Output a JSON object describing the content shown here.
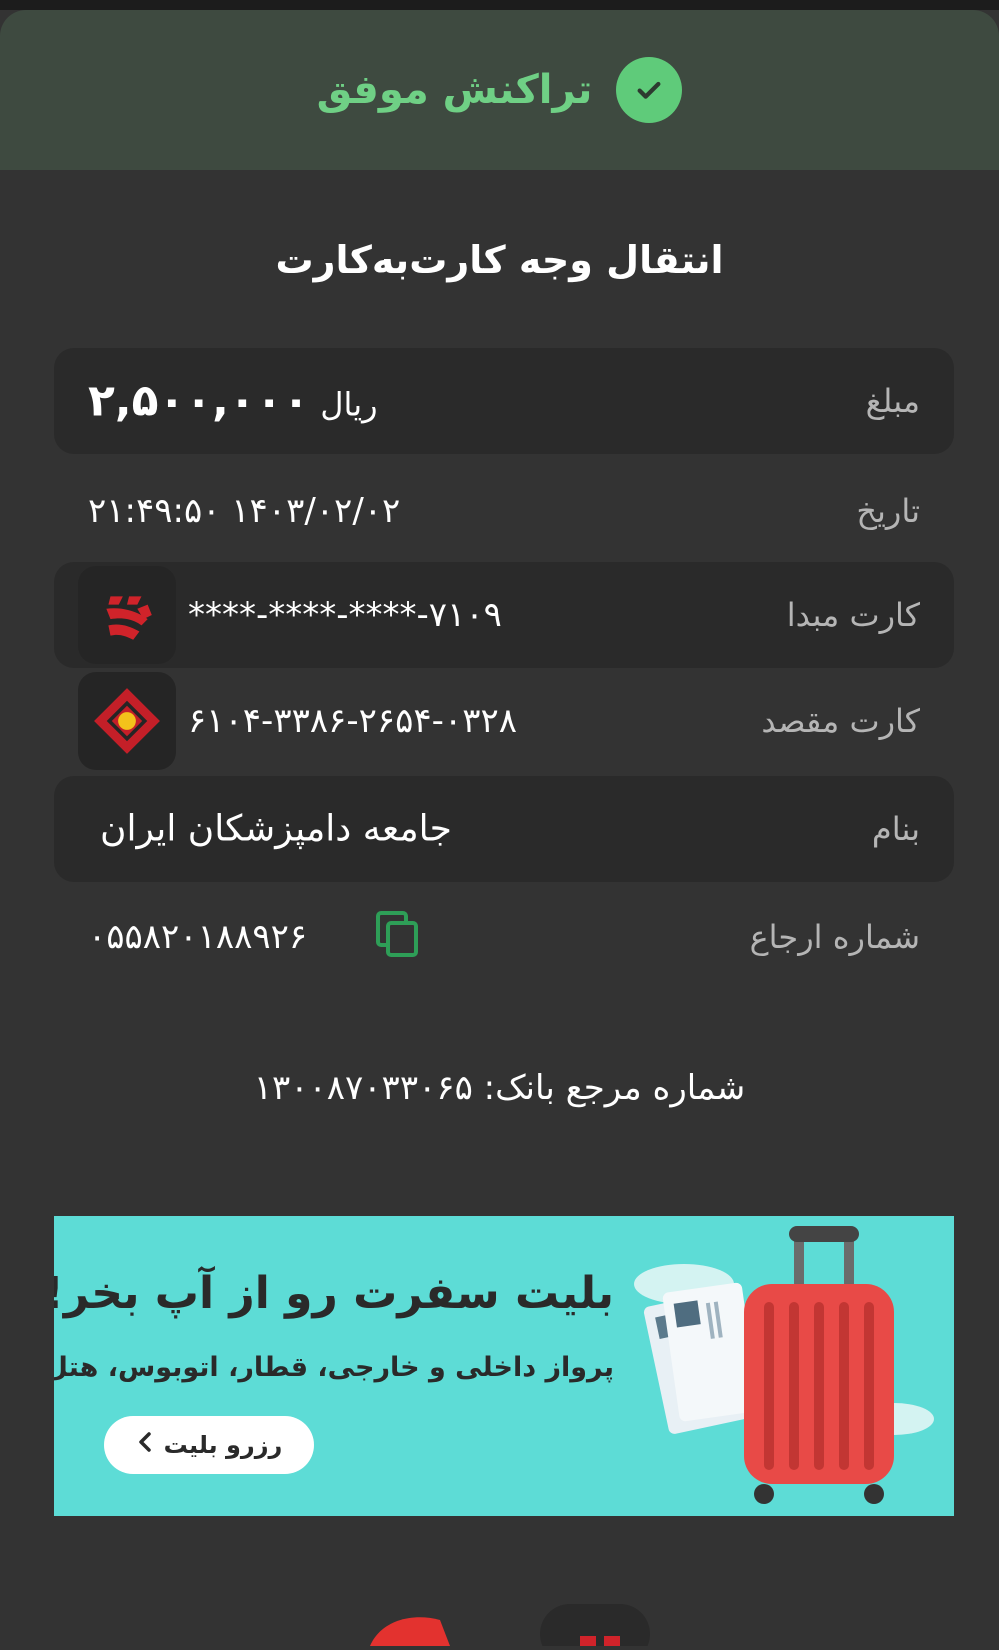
{
  "header": {
    "status": "تراکنش موفق"
  },
  "title": "انتقال وجه کارت‌به‌کارت",
  "amount": {
    "label": "مبلغ",
    "value": "۲,۵۰۰,۰۰۰",
    "unit": "ریال"
  },
  "date": {
    "label": "تاریخ",
    "value": "۲۱:۴۹:۵۰ ۱۴۰۳/۰۲/۰۲"
  },
  "source_card": {
    "label": "کارت مبدا",
    "value": "****-****-****-۷۱۰۹",
    "bank_icon": "shahr-bank-logo-icon"
  },
  "dest_card": {
    "label": "کارت مقصد",
    "value": "۶۱۰۴-۳۳۸۶-۲۶۵۴-۰۳۲۸",
    "bank_icon": "mellat-bank-logo-icon"
  },
  "recipient": {
    "label": "بنام",
    "value": "جامعه دامپزشکان ایران"
  },
  "reference": {
    "label": "شماره ارجاع",
    "value": "۰۵۵۸۲۰۱۸۸۹۲۶"
  },
  "bank_reference": "شماره مرجع بانک: ۱۳۰۰۸۷۰۳۳۰۶۵",
  "banner": {
    "title": "بلیت سفرت رو از آپ بخر!",
    "subtitle": "پرواز داخلی و خارجی، قطار، اتوبوس، هتل",
    "button": "رزرو بلیت"
  },
  "colors": {
    "success": "#5fcb7a",
    "header_bg": "#3e4a40",
    "banner_bg": "#5ddcd6",
    "bank_red": "#d0232a"
  }
}
